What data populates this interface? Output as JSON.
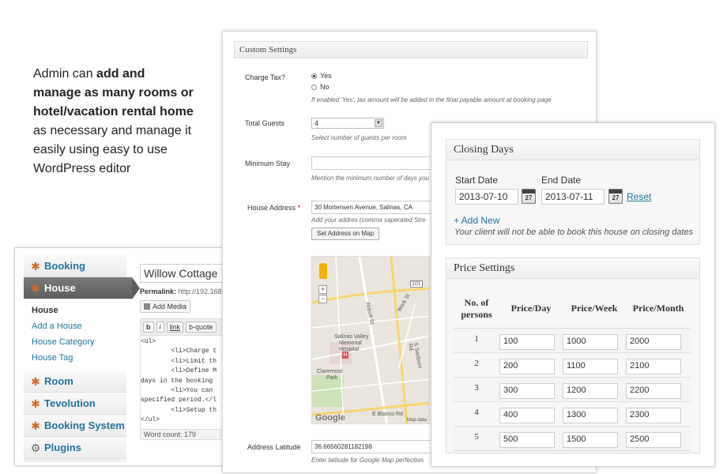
{
  "intro": {
    "t1": "Admin can ",
    "b1": "add  and manage as many rooms or hotel/vacation rental home",
    "t2": " as necessary and manage it easily using easy to use WordPress editor"
  },
  "wp": {
    "menu": {
      "booking": "Booking",
      "house": "House",
      "sub": [
        "House",
        "Add a House",
        "House Category",
        "House Tag"
      ],
      "room": "Room",
      "tevolution": "Tevolution",
      "booking_system": "Booking System",
      "plugins": "Plugins"
    },
    "title_value": "Willow Cottage",
    "permalink_label": "Permalink:",
    "permalink_value": "http://192.168.",
    "add_media": "Add Media",
    "qt_buttons": [
      "b",
      "i",
      "link",
      "b-quote"
    ],
    "code": "<ul>\n        <li>Charge t\n        <li>Limit th\n        <li>Define M\ndays in the booking\n        <li>You can \nspecified period.</l\n        <li>Setup th\n</ul>",
    "word_count_label": "Word count:",
    "word_count": "179"
  },
  "custom": {
    "header": "Custom Settings",
    "charge_tax_label": "Charge Tax?",
    "yes": "Yes",
    "no": "No",
    "tax_hint": "If enabled 'Yes', tax amount will be added in the final payable amount at booking page",
    "guests_label": "Total Guests",
    "guests_value": "4",
    "guests_hint": "Select number of guests per room",
    "min_stay_label": "Minimum Stay",
    "min_stay_hint": "Mention the minimum number of days you",
    "address_label": "House Address",
    "address_req": "*",
    "address_value": "30 Mortensen Avenue, Salinas, CA",
    "address_hint": "Add your addres (comma saperated Stre",
    "set_address": "Set Address on Map",
    "map": {
      "l1": "Abbott St",
      "l2": "Work St",
      "l3": "Salinas Valley",
      "l4": "Memorial",
      "l5": "Hospital",
      "l6": "Claremont",
      "l7": "Park",
      "l8": "E Blanco Rd",
      "l9": "Google",
      "l10": "Map data",
      "l11": "101",
      "l12": "S Sanborn Rd"
    },
    "lat_label": "Address Latitude",
    "lat_value": "36.66560281182198",
    "lat_hint": "Enter latitude for Google Map perfection."
  },
  "closing": {
    "header": "Closing Days",
    "start_label": "Start Date",
    "start_value": "2013-07-10",
    "end_label": "End Date",
    "end_value": "2013-07-11",
    "cal_num": "27",
    "reset": "Reset",
    "add_new": "+ Add New",
    "hint": "Your client will not be able to book this house on closing dates"
  },
  "price": {
    "header": "Price Settings",
    "columns": [
      "No. of persons",
      "Price/Day",
      "Price/Week",
      "Price/Month"
    ],
    "rows": [
      {
        "n": "1",
        "day": "100",
        "week": "1000",
        "month": "2000"
      },
      {
        "n": "2",
        "day": "200",
        "week": "1100",
        "month": "2100"
      },
      {
        "n": "3",
        "day": "300",
        "week": "1200",
        "month": "2200"
      },
      {
        "n": "4",
        "day": "400",
        "week": "1300",
        "month": "2300"
      },
      {
        "n": "5",
        "day": "500",
        "week": "1500",
        "month": "2500"
      }
    ]
  },
  "colors": {
    "link": "#21759b",
    "menu_active": "#5e5e5e",
    "icon": "#d26b24"
  }
}
